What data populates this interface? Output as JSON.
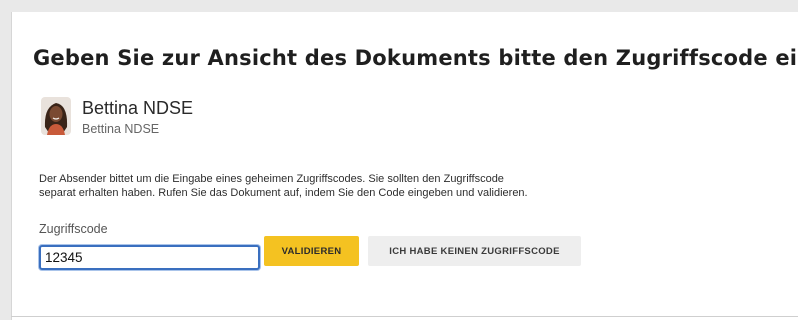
{
  "page": {
    "title": "Geben Sie zur Ansicht des Dokuments bitte den Zugriffscode ein"
  },
  "sender": {
    "name": "Bettina NDSE",
    "sub": "Bettina NDSE",
    "avatar_icon": "person-avatar"
  },
  "description": {
    "line1": "Der Absender bittet um die Eingabe eines geheimen Zugriffscodes. Sie sollten den Zugriffscode",
    "line2": "separat erhalten haben. Rufen Sie das Dokument auf, indem Sie den Code eingeben und validieren."
  },
  "form": {
    "label": "Zugriffscode",
    "value": "12345",
    "validate_label": "VALIDIEREN",
    "no_code_label": "ICH HABE KEINEN ZUGRIFFSCODE"
  },
  "colors": {
    "accent": "#f4c221",
    "focus_border": "#3a6fbf",
    "secondary_button": "#eeeeee"
  }
}
